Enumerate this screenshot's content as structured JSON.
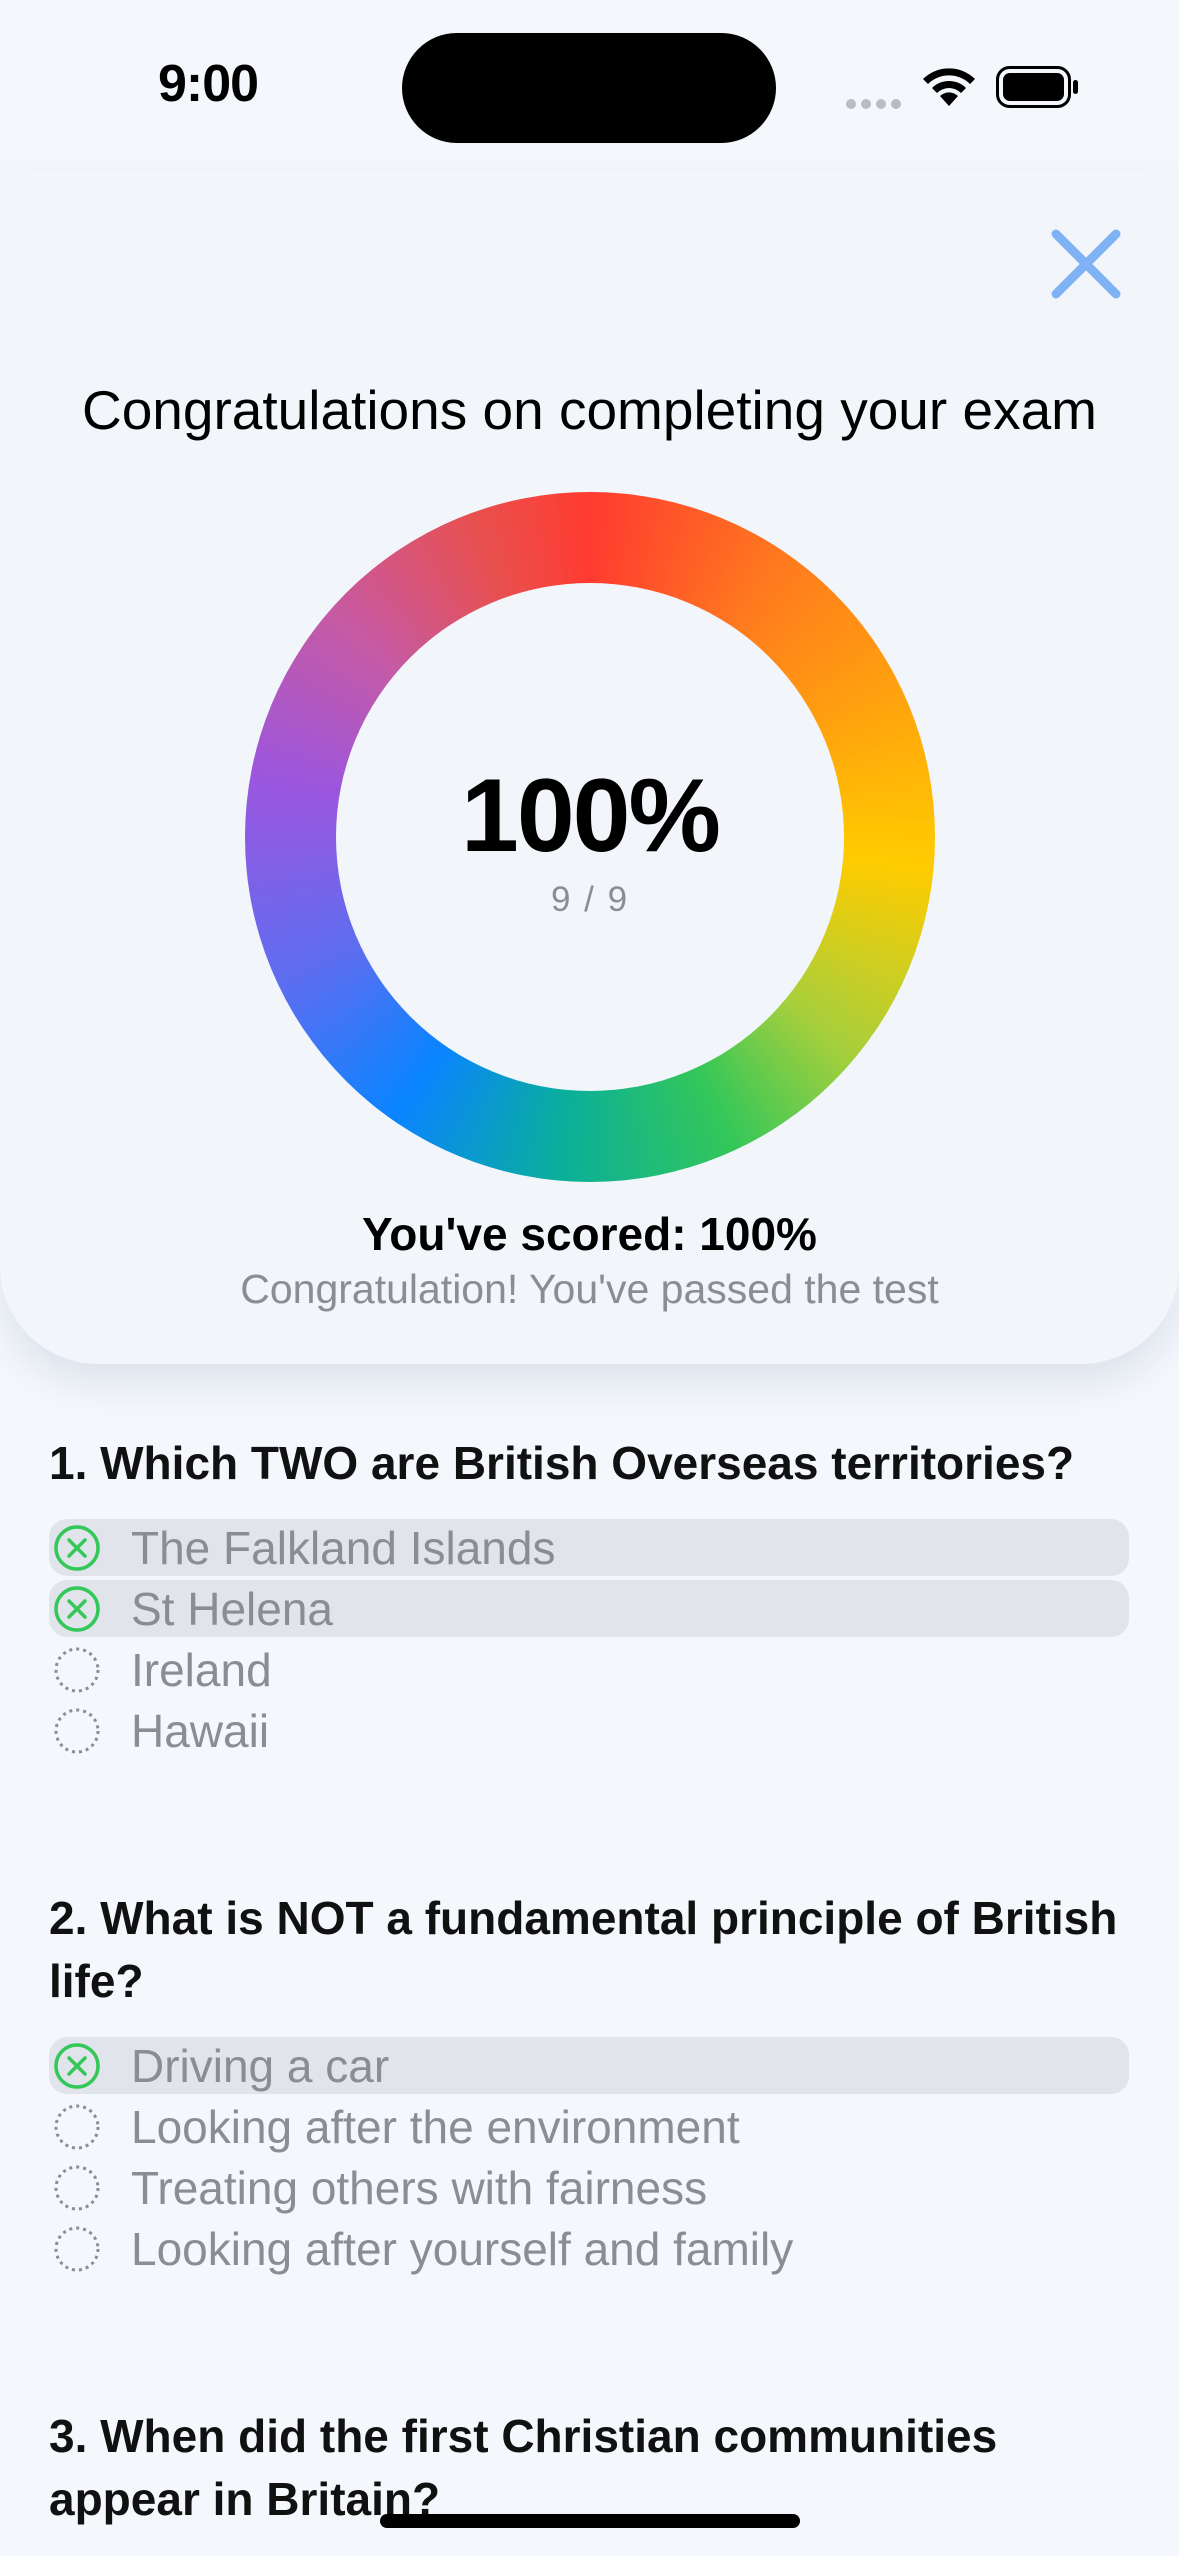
{
  "status_bar": {
    "time": "9:00"
  },
  "header": {
    "close_icon": "close-x-icon"
  },
  "results": {
    "title": "Congratulations on completing your exam",
    "score_percent": "100%",
    "score_fraction": "9 / 9",
    "scored_line": "You've scored: 100%",
    "passed_line": "Congratulation! You've passed the test"
  },
  "questions": [
    {
      "text": "1. Which TWO are British Overseas territories?",
      "options": [
        {
          "label": "The Falkland Islands",
          "selected": true
        },
        {
          "label": "St Helena",
          "selected": true
        },
        {
          "label": "Ireland",
          "selected": false
        },
        {
          "label": "Hawaii",
          "selected": false
        }
      ]
    },
    {
      "text": "2. What is NOT a fundamental principle of British life?",
      "options": [
        {
          "label": "Driving a car",
          "selected": true
        },
        {
          "label": "Looking after the environment",
          "selected": false
        },
        {
          "label": "Treating others with fairness",
          "selected": false
        },
        {
          "label": "Looking after yourself and family",
          "selected": false
        }
      ]
    },
    {
      "text": "3. When did the first Christian communities appear in Britain?",
      "options": []
    }
  ],
  "colors": {
    "accent_close": "#7fb3f5",
    "correct_green": "#34c759",
    "muted_text": "#8a8d93",
    "selected_bg": "#e1e4ea"
  }
}
